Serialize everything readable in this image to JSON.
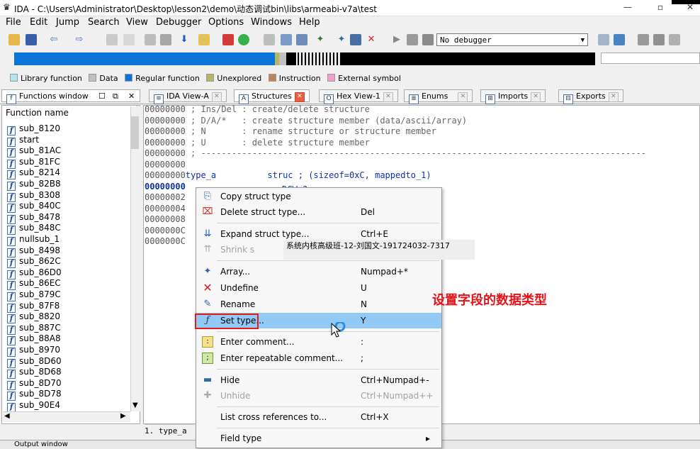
{
  "window": {
    "title": "IDA - C:\\Users\\Administrator\\Desktop\\lesson2\\demo\\动态调试bin\\libs\\armeabi-v7a\\test",
    "controls": [
      "—",
      "▫",
      "✕"
    ]
  },
  "menu": [
    "File",
    "Edit",
    "Jump",
    "Search",
    "View",
    "Debugger",
    "Options",
    "Windows",
    "Help"
  ],
  "toolbar": {
    "debugger_value": "No debugger"
  },
  "legend": [
    {
      "label": "Library function",
      "color": "#aee8ee"
    },
    {
      "label": "Data",
      "color": "#c0c0c0"
    },
    {
      "label": "Regular function",
      "color": "#0a74d8"
    },
    {
      "label": "Unexplored",
      "color": "#b5b564"
    },
    {
      "label": "Instruction",
      "color": "#c0825a"
    },
    {
      "label": "External symbol",
      "color": "#f29cd1"
    }
  ],
  "tabs": {
    "functions": "Functions window",
    "ida_view": "IDA View-A",
    "structures": "Structures",
    "hex_view": "Hex View-1",
    "enums": "Enums",
    "imports": "Imports",
    "exports": "Exports"
  },
  "functions": {
    "header": "Function name",
    "items": [
      "sub_8120",
      "start",
      "sub_81AC",
      "sub_81FC",
      "sub_8214",
      "sub_82B8",
      "sub_8308",
      "sub_840C",
      "sub_8478",
      "sub_848C",
      "nullsub_1",
      "sub_8498",
      "sub_862C",
      "sub_86D0",
      "sub_86EC",
      "sub_879C",
      "sub_87F8",
      "sub_8820",
      "sub_887C",
      "sub_88A8",
      "sub_8970",
      "sub_8D60",
      "sub_8D68",
      "sub_8D70",
      "sub_8D78",
      "sub_90E4"
    ]
  },
  "structures": {
    "lines": [
      {
        "addr": "00000000",
        "text": " ; Ins/Del : create/delete structure"
      },
      {
        "addr": "00000000",
        "text": " ; D/A/*   : create structure member (data/ascii/array)"
      },
      {
        "addr": "00000000",
        "text": " ; N       : rename structure or structure member"
      },
      {
        "addr": "00000000",
        "text": " ; U       : delete structure member"
      },
      {
        "addr": "00000000",
        "text": " ; ---------------------------------------------------------------------------------------"
      },
      {
        "addr": "00000000",
        "text": ""
      },
      {
        "addr": "00000000",
        "text": "type_a          struc ; (sizeof=0xC, mappedto_1)"
      },
      {
        "addr": "00000000",
        "text": ""
      },
      {
        "addr": "00000002",
        "text": ""
      },
      {
        "addr": "00000004",
        "text": ""
      },
      {
        "addr": "00000008",
        "text": ""
      },
      {
        "addr": "0000000C",
        "text": ""
      },
      {
        "addr": "0000000C",
        "text": ""
      }
    ],
    "struct_name": "type_a",
    "bottom_line": "1. type_a"
  },
  "context_menu": {
    "items": [
      {
        "label": "Copy struct type",
        "shortcut": ""
      },
      {
        "label": "Delete struct type...",
        "shortcut": "Del"
      },
      {
        "label": "Expand struct type...",
        "shortcut": "Ctrl+E"
      },
      {
        "label": "Shrink s",
        "shortcut": ""
      },
      {
        "label": "Array...",
        "shortcut": "Numpad+*"
      },
      {
        "label": "Undefine",
        "shortcut": "U"
      },
      {
        "label": "Rename",
        "shortcut": "N"
      },
      {
        "label": "Set type...",
        "shortcut": "Y"
      },
      {
        "label": "Enter comment...",
        "shortcut": ":"
      },
      {
        "label": "Enter repeatable comment...",
        "shortcut": ";"
      },
      {
        "label": "Hide",
        "shortcut": "Ctrl+Numpad+-"
      },
      {
        "label": "Unhide",
        "shortcut": "Ctrl+Numpad++"
      },
      {
        "label": "List cross references to...",
        "shortcut": "Ctrl+X"
      },
      {
        "label": "Field type",
        "shortcut": "▸"
      }
    ]
  },
  "overlay": {
    "watermark": "系统内核高级班-12-刘国文-191724032-7317",
    "annotation": "设置字段的数据类型",
    "highlight_color": "#e21b1b"
  },
  "statusbar": {
    "text": "Output window"
  }
}
